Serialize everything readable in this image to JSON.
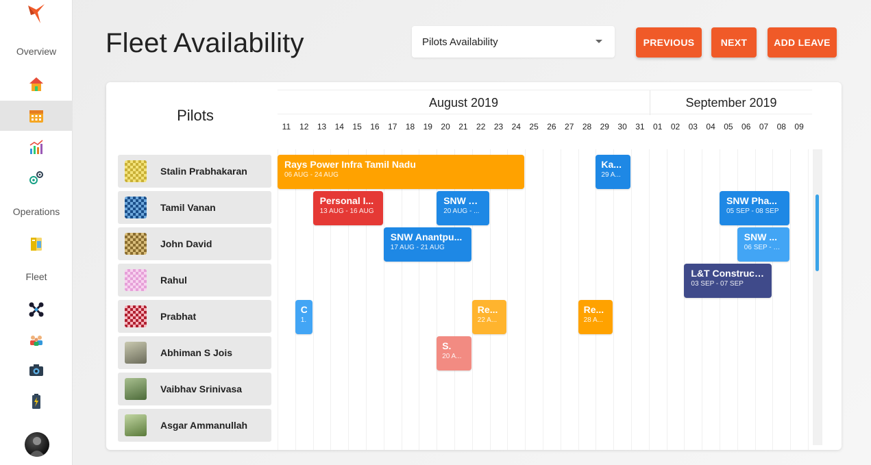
{
  "app": {
    "title": "Fleet Availability"
  },
  "sidebar": {
    "sections": {
      "overview": "Overview",
      "operations": "Operations",
      "fleet": "Fleet"
    }
  },
  "header": {
    "select_value": "Pilots Availability",
    "previous_label": "PREVIOUS",
    "next_label": "NEXT",
    "add_leave_label": "ADD LEAVE"
  },
  "colors": {
    "accent": "#f05a28",
    "orange_event": "#ffa200",
    "blue_event": "#1e88e5",
    "red_event": "#e53935",
    "navy_event": "#3f4a8a",
    "light_red_event": "#f28b82",
    "light_orange_event": "#ffb42e"
  },
  "calendar": {
    "pilots_heading": "Pilots",
    "months": [
      "August 2019",
      "September 2019"
    ],
    "days": [
      "11",
      "12",
      "13",
      "14",
      "15",
      "16",
      "17",
      "18",
      "19",
      "20",
      "21",
      "22",
      "23",
      "24",
      "25",
      "26",
      "27",
      "28",
      "29",
      "30",
      "31",
      "01",
      "02",
      "03",
      "04",
      "05",
      "06",
      "07",
      "08",
      "09"
    ]
  },
  "pilots": [
    {
      "name": "Stalin Prabhakaran"
    },
    {
      "name": "Tamil Vanan"
    },
    {
      "name": "John David"
    },
    {
      "name": "Rahul"
    },
    {
      "name": "Prabhat"
    },
    {
      "name": "Abhiman S Jois"
    },
    {
      "name": "Vaibhav Srinivasa"
    },
    {
      "name": "Asgar Ammanullah"
    }
  ],
  "events": [
    {
      "row": 0,
      "title": "Rays Power Infra Tamil Nadu",
      "dates": "06 AUG - 24 AUG",
      "color": "#ffa200"
    },
    {
      "row": 0,
      "title": "Ka...",
      "dates": "29 A...",
      "color": "#1e88e5"
    },
    {
      "row": 1,
      "title": "Personal I...",
      "dates": "13 AUG - 16 AUG",
      "color": "#e53935"
    },
    {
      "row": 1,
      "title": "SNW A...",
      "dates": "20 AUG - ...",
      "color": "#1e88e5"
    },
    {
      "row": 1,
      "title": "SNW Pha...",
      "dates": "05 SEP - 08 SEP",
      "color": "#1e88e5"
    },
    {
      "row": 2,
      "title": "SNW Anantpu...",
      "dates": "17 AUG - 21 AUG",
      "color": "#1e88e5"
    },
    {
      "row": 2,
      "title": "SNW ...",
      "dates": "06 SEP - 0...",
      "color": "#42a5f5"
    },
    {
      "row": 3,
      "title": "L&T Construct...",
      "dates": "03 SEP - 07 SEP",
      "color": "#3f4a8a"
    },
    {
      "row": 4,
      "title": "C.",
      "dates": "1.",
      "color": "#42a5f5"
    },
    {
      "row": 4,
      "title": "Re...",
      "dates": "22 A...",
      "color": "#ffb42e"
    },
    {
      "row": 4,
      "title": "Re...",
      "dates": "28 A...",
      "color": "#ffa200"
    },
    {
      "row": 5,
      "title": "S.",
      "dates": "20 A...",
      "color": "#f28b82"
    }
  ]
}
